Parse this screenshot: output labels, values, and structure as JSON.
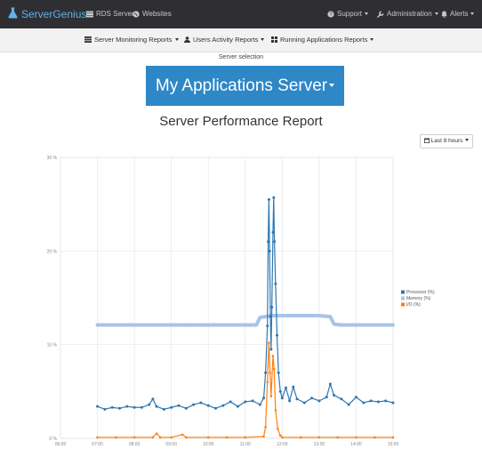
{
  "topnav": {
    "brand": "ServerGenius",
    "links": {
      "rds": "RDS Servers",
      "websites": "Websites",
      "support": "Support",
      "administration": "Administration",
      "alerts": "Alerts"
    }
  },
  "subnav": {
    "server_monitoring": "Server Monitoring Reports",
    "users_activity": "Users Activity Reports",
    "running_apps": "Running Applications Reports"
  },
  "server": {
    "label": "Server selection",
    "selected": "My Applications Server"
  },
  "report": {
    "title": "Server Performance Report",
    "range": "Last 8 hours"
  },
  "colors": {
    "navbar": "#2f2f33",
    "brand": "#5fb2e6",
    "accent": "#2e87c6",
    "processor": "#2e78b2",
    "memory": "#a8c3e8",
    "io": "#ff7f0e"
  },
  "icons": {
    "brand": "flask-icon",
    "rds": "server-icon",
    "websites": "globe-icon",
    "support": "question-circle-icon",
    "administration": "wrench-icon",
    "alerts": "bell-icon",
    "server_monitoring": "server-icon",
    "users_activity": "user-icon",
    "running_apps": "th-icon",
    "range": "calendar-icon"
  },
  "chart_data": {
    "type": "line",
    "ylim": [
      0,
      30
    ],
    "yticks": [
      "0 %",
      "10 %",
      "20 %",
      "30 %"
    ],
    "xticks": [
      "06:00",
      "07:00",
      "08:00",
      "09:00",
      "10:00",
      "11:00",
      "12:00",
      "13:00",
      "14:00",
      "15:00"
    ],
    "xlim": [
      6,
      15
    ],
    "grid": true,
    "legend": "right",
    "series": [
      {
        "name": "Processor (%)",
        "color": "#2e78b2",
        "points": [
          [
            7.0,
            3.4
          ],
          [
            7.2,
            3.1
          ],
          [
            7.4,
            3.3
          ],
          [
            7.6,
            3.2
          ],
          [
            7.8,
            3.4
          ],
          [
            8.0,
            3.3
          ],
          [
            8.2,
            3.3
          ],
          [
            8.4,
            3.6
          ],
          [
            8.5,
            4.2
          ],
          [
            8.6,
            3.4
          ],
          [
            8.8,
            3.1
          ],
          [
            9.0,
            3.3
          ],
          [
            9.2,
            3.5
          ],
          [
            9.4,
            3.2
          ],
          [
            9.6,
            3.6
          ],
          [
            9.8,
            3.8
          ],
          [
            10.0,
            3.5
          ],
          [
            10.2,
            3.2
          ],
          [
            10.4,
            3.5
          ],
          [
            10.6,
            3.9
          ],
          [
            10.8,
            3.4
          ],
          [
            11.0,
            3.9
          ],
          [
            11.2,
            4.0
          ],
          [
            11.4,
            3.6
          ],
          [
            11.5,
            4.3
          ],
          [
            11.55,
            7.0
          ],
          [
            11.6,
            12.0
          ],
          [
            11.62,
            21.0
          ],
          [
            11.64,
            25.5
          ],
          [
            11.66,
            20.0
          ],
          [
            11.68,
            13.0
          ],
          [
            11.7,
            9.5
          ],
          [
            11.72,
            14.0
          ],
          [
            11.75,
            22.0
          ],
          [
            11.77,
            25.7
          ],
          [
            11.79,
            21.0
          ],
          [
            11.82,
            16.5
          ],
          [
            11.86,
            11.0
          ],
          [
            11.9,
            7.0
          ],
          [
            11.95,
            5.0
          ],
          [
            12.0,
            4.3
          ],
          [
            12.1,
            5.4
          ],
          [
            12.2,
            4.0
          ],
          [
            12.3,
            5.5
          ],
          [
            12.4,
            4.2
          ],
          [
            12.6,
            3.8
          ],
          [
            12.8,
            4.3
          ],
          [
            13.0,
            4.0
          ],
          [
            13.2,
            4.4
          ],
          [
            13.3,
            5.8
          ],
          [
            13.4,
            4.6
          ],
          [
            13.6,
            4.2
          ],
          [
            13.8,
            3.6
          ],
          [
            14.0,
            4.4
          ],
          [
            14.2,
            3.8
          ],
          [
            14.4,
            4.0
          ],
          [
            14.6,
            3.9
          ],
          [
            14.8,
            4.0
          ],
          [
            15.0,
            3.8
          ]
        ]
      },
      {
        "name": "Memory (%)",
        "color": "#a8c3e8",
        "points": [
          [
            7.0,
            12.1
          ],
          [
            7.5,
            12.1
          ],
          [
            8.0,
            12.1
          ],
          [
            8.5,
            12.1
          ],
          [
            9.0,
            12.1
          ],
          [
            9.5,
            12.1
          ],
          [
            10.0,
            12.1
          ],
          [
            10.5,
            12.1
          ],
          [
            11.0,
            12.1
          ],
          [
            11.3,
            12.1
          ],
          [
            11.4,
            12.9
          ],
          [
            11.7,
            13.1
          ],
          [
            12.0,
            13.1
          ],
          [
            12.5,
            13.1
          ],
          [
            13.0,
            13.1
          ],
          [
            13.3,
            13.0
          ],
          [
            13.4,
            12.2
          ],
          [
            13.6,
            12.1
          ],
          [
            14.0,
            12.1
          ],
          [
            14.5,
            12.1
          ],
          [
            15.0,
            12.1
          ]
        ]
      },
      {
        "name": "I/O (%)",
        "color": "#ff7f0e",
        "points": [
          [
            7.0,
            0.1
          ],
          [
            7.5,
            0.1
          ],
          [
            8.0,
            0.1
          ],
          [
            8.5,
            0.1
          ],
          [
            8.6,
            0.5
          ],
          [
            8.7,
            0.1
          ],
          [
            9.0,
            0.1
          ],
          [
            9.3,
            0.4
          ],
          [
            9.4,
            0.1
          ],
          [
            10.0,
            0.1
          ],
          [
            10.5,
            0.1
          ],
          [
            11.0,
            0.1
          ],
          [
            11.5,
            0.2
          ],
          [
            11.55,
            1.2
          ],
          [
            11.6,
            6.0
          ],
          [
            11.64,
            10.2
          ],
          [
            11.67,
            7.0
          ],
          [
            11.7,
            4.5
          ],
          [
            11.75,
            8.8
          ],
          [
            11.78,
            7.4
          ],
          [
            11.82,
            3.0
          ],
          [
            11.88,
            1.0
          ],
          [
            11.95,
            0.3
          ],
          [
            12.0,
            0.1
          ],
          [
            12.5,
            0.1
          ],
          [
            13.0,
            0.1
          ],
          [
            13.5,
            0.1
          ],
          [
            14.0,
            0.1
          ],
          [
            14.5,
            0.1
          ],
          [
            15.0,
            0.1
          ]
        ]
      }
    ]
  }
}
